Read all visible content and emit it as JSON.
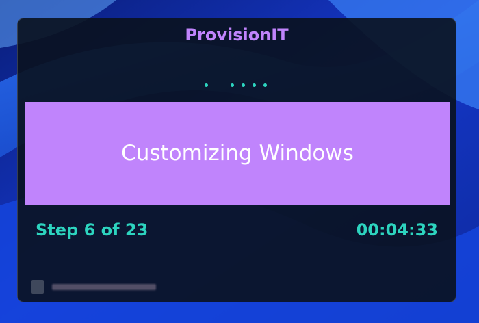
{
  "app": {
    "title": "ProvisionIT"
  },
  "progress_dots": {
    "color": "#2dd4bf",
    "count": 5
  },
  "status": {
    "message": "Customizing Windows",
    "banner_color": "#c084fc"
  },
  "footer": {
    "step_text": "Step 6 of 23",
    "elapsed_time": "00:04:33",
    "text_color": "#2dd4bf"
  },
  "wallpaper": {
    "name": "windows-bloom-wallpaper",
    "primary_color": "#1d4ed8"
  }
}
